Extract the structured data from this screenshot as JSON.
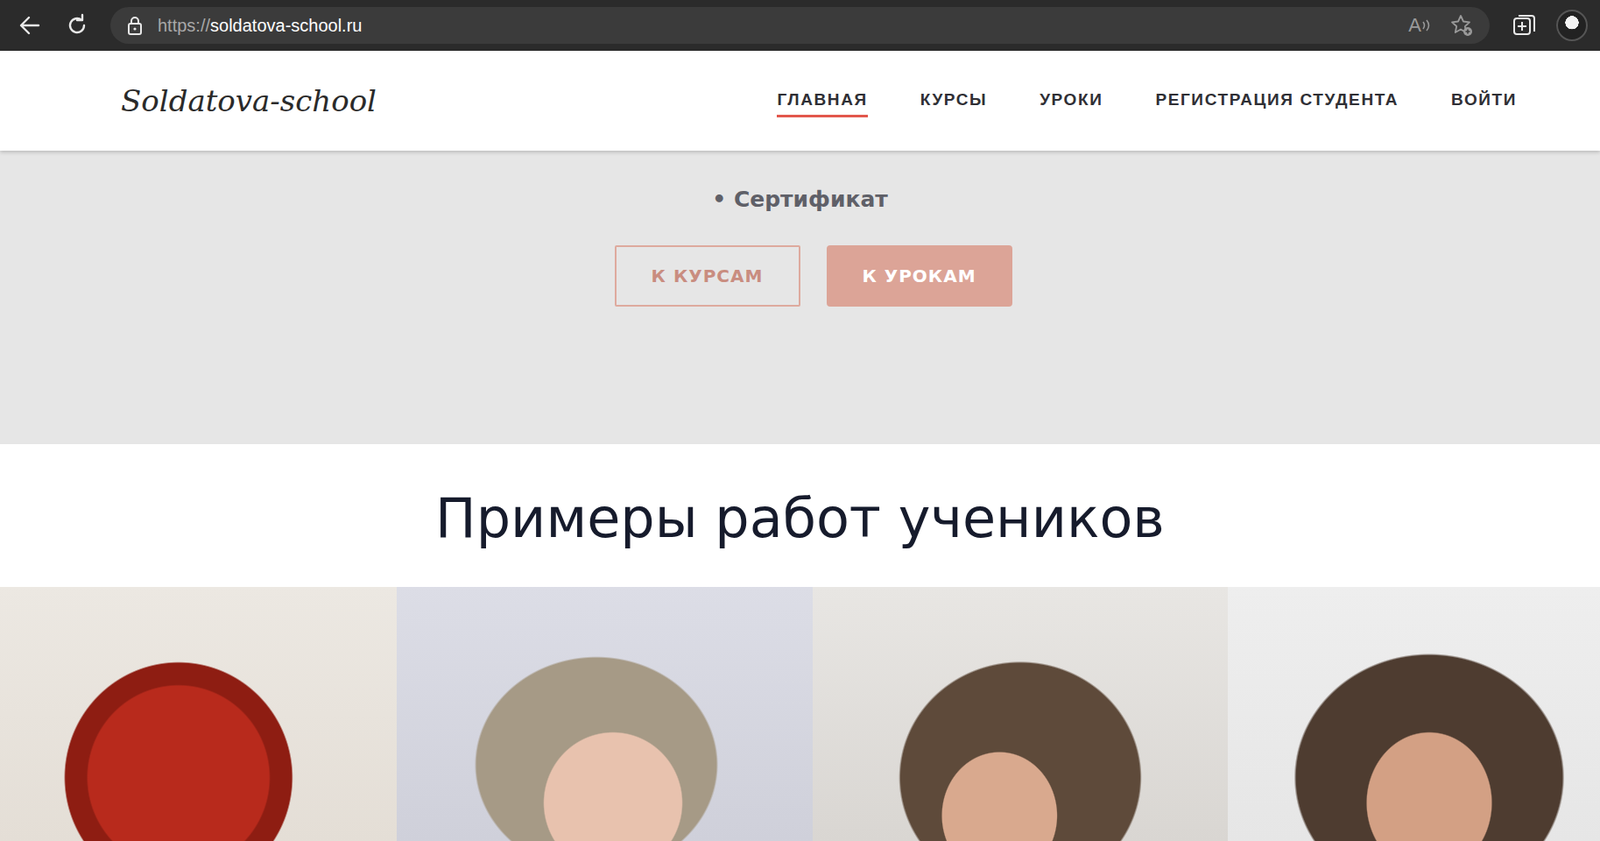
{
  "browser": {
    "url_scheme": "https://",
    "url_host": "soldatova-school.ru",
    "read_aloud_icon": "A"
  },
  "site": {
    "logo": "Soldatova-school",
    "nav": [
      {
        "label": "ГЛАВНАЯ",
        "selected": true
      },
      {
        "label": "КУРСЫ",
        "selected": false
      },
      {
        "label": "УРОКИ",
        "selected": false
      },
      {
        "label": "РЕГИСТРАЦИЯ СТУДЕНТА",
        "selected": false
      },
      {
        "label": "ВОЙТИ",
        "selected": false
      }
    ]
  },
  "hero": {
    "bullet": "• Сертификат",
    "buttons": [
      {
        "label": "К КУРСАМ",
        "kind": "outline"
      },
      {
        "label": "К УРОКАМ",
        "kind": "filled"
      }
    ]
  },
  "gallery": {
    "title": "Примеры работ учеников"
  }
}
